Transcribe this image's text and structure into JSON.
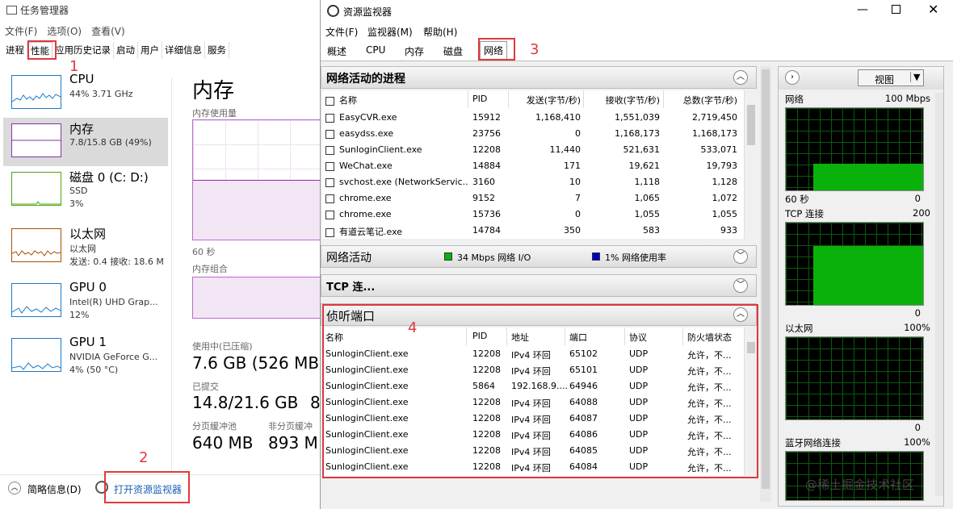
{
  "taskmgr": {
    "title": "任务管理器",
    "menu": [
      "文件(F)",
      "选项(O)",
      "查看(V)"
    ],
    "tabs": [
      "进程",
      "性能",
      "应用历史记录",
      "启动",
      "用户",
      "详细信息",
      "服务"
    ],
    "active_tab": "性能",
    "devices": [
      {
        "name": "CPU",
        "line2": "44%  3.71 GHz",
        "line3": "",
        "color": "#1979ca"
      },
      {
        "name": "内存",
        "line2": "7.8/15.8 GB (49%)",
        "line3": "",
        "color": "#8b2fa8"
      },
      {
        "name": "磁盘 0 (C: D:)",
        "line2": "SSD",
        "line3": "3%",
        "color": "#4da60c"
      },
      {
        "name": "以太网",
        "line2": "以太网",
        "line3": "发送: 0.4  接收: 18.6 M",
        "color": "#a74f01"
      },
      {
        "name": "GPU 0",
        "line2": "Intel(R) UHD Grap...",
        "line3": "12%",
        "color": "#1979ca"
      },
      {
        "name": "GPU 1",
        "line2": "NVIDIA GeForce G...",
        "line3": "4% (50 °C)",
        "color": "#1979ca"
      }
    ],
    "detail": {
      "title": "内存",
      "usage_label": "内存使用量",
      "time_label": "60 秒",
      "composition_label": "内存组合",
      "in_use_label": "使用中(已压缩)",
      "in_use_value": "7.6 GB (526 MB)",
      "committed_label": "已提交",
      "committed_value": "14.8/21.6 GB",
      "cut_value": "8",
      "paged_label": "分页缓冲池",
      "paged_value": "640 MB",
      "nonpaged_label": "非分页缓冲",
      "nonpaged_value": "893 M"
    },
    "footer": {
      "summary": "简略信息(D)",
      "open_resmon": "打开资源监视器"
    }
  },
  "annotations": [
    "1",
    "2",
    "3",
    "4"
  ],
  "resmon": {
    "title": "资源监视器",
    "menu": [
      "文件(F)",
      "监视器(M)",
      "帮助(H)"
    ],
    "tabs": [
      "概述",
      "CPU",
      "内存",
      "磁盘",
      "网络"
    ],
    "active_tab": "网络",
    "proc_panel": {
      "title": "网络活动的进程",
      "columns": [
        "名称",
        "PID",
        "发送(字节/秒)",
        "接收(字节/秒)",
        "总数(字节/秒)"
      ],
      "rows": [
        [
          "EasyCVR.exe",
          "15912",
          "1,168,410",
          "1,551,039",
          "2,719,450"
        ],
        [
          "easydss.exe",
          "23756",
          "0",
          "1,168,173",
          "1,168,173"
        ],
        [
          "SunloginClient.exe",
          "12208",
          "11,440",
          "521,631",
          "533,071"
        ],
        [
          "WeChat.exe",
          "14884",
          "171",
          "19,621",
          "19,793"
        ],
        [
          "svchost.exe (NetworkServic...",
          "3160",
          "10",
          "1,118",
          "1,128"
        ],
        [
          "chrome.exe",
          "9152",
          "7",
          "1,065",
          "1,072"
        ],
        [
          "chrome.exe",
          "15736",
          "0",
          "1,055",
          "1,055"
        ],
        [
          "有道云笔记.exe",
          "14784",
          "350",
          "583",
          "933"
        ]
      ]
    },
    "net_panel": {
      "title": "网络活动",
      "io": "34 Mbps 网络 I/O",
      "usage": "1% 网络使用率"
    },
    "tcp_panel": {
      "title": "TCP 连..."
    },
    "listen_panel": {
      "title": "侦听端口",
      "columns": [
        "名称",
        "PID",
        "地址",
        "端口",
        "协议",
        "防火墙状态"
      ],
      "rows": [
        [
          "SunloginClient.exe",
          "12208",
          "IPv4 环回",
          "65102",
          "UDP",
          "允许，不..."
        ],
        [
          "SunloginClient.exe",
          "12208",
          "IPv4 环回",
          "65101",
          "UDP",
          "允许，不..."
        ],
        [
          "SunloginClient.exe",
          "5864",
          "192.168.9....",
          "64946",
          "UDP",
          "允许，不..."
        ],
        [
          "SunloginClient.exe",
          "12208",
          "IPv4 环回",
          "64088",
          "UDP",
          "允许，不..."
        ],
        [
          "SunloginClient.exe",
          "12208",
          "IPv4 环回",
          "64087",
          "UDP",
          "允许，不..."
        ],
        [
          "SunloginClient.exe",
          "12208",
          "IPv4 环回",
          "64086",
          "UDP",
          "允许，不..."
        ],
        [
          "SunloginClient.exe",
          "12208",
          "IPv4 环回",
          "64085",
          "UDP",
          "允许，不..."
        ],
        [
          "SunloginClient.exe",
          "12208",
          "IPv4 环回",
          "64084",
          "UDP",
          "允许，不..."
        ]
      ]
    },
    "side": {
      "view_label": "视图",
      "graphs": [
        {
          "label": "网络",
          "max": "100 Mbps",
          "foot_left": "60 秒",
          "foot_right": "0",
          "level": 0.32
        },
        {
          "label": "TCP 连接",
          "max": "200",
          "foot_left": "",
          "foot_right": "0",
          "level": 0.72
        },
        {
          "label": "以太网",
          "max": "100%",
          "foot_left": "",
          "foot_right": "0",
          "level": 0.0
        },
        {
          "label": "蓝牙网络连接",
          "max": "100%",
          "foot_left": "",
          "foot_right": "",
          "level": 0.0
        }
      ]
    },
    "watermark": "@稀土掘金技术社区"
  }
}
